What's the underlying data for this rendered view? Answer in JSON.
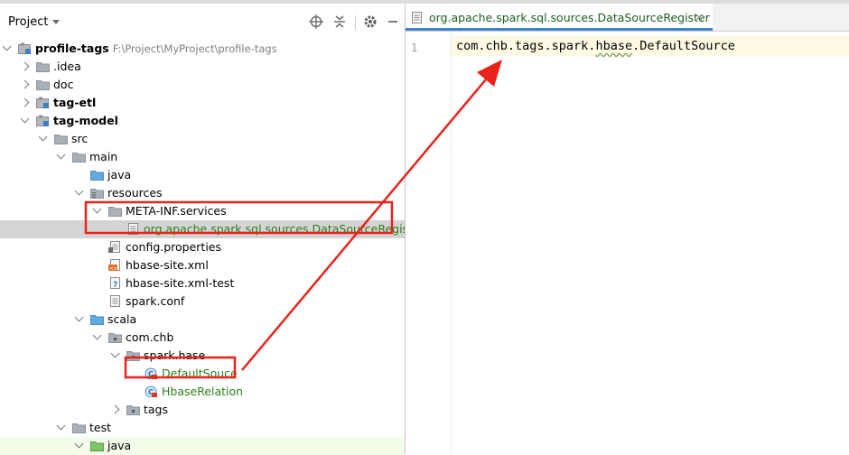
{
  "project_panel": {
    "title": "Project",
    "toolbar_icons": [
      "locate-icon",
      "collapse-icon",
      "gear-icon",
      "hide-icon"
    ]
  },
  "tree": [
    {
      "label": "profile-tags",
      "extra": "F:\\Project\\MyProject\\profile-tags",
      "bold": true,
      "icon": "module-icon",
      "expander": "open"
    },
    {
      "label": ".idea",
      "icon": "folder-icon",
      "expander": "closed"
    },
    {
      "label": "doc",
      "icon": "folder-icon",
      "expander": "closed"
    },
    {
      "label": "tag-etl",
      "bold": true,
      "icon": "module-icon",
      "expander": "closed"
    },
    {
      "label": "tag-model",
      "bold": true,
      "icon": "module-icon",
      "expander": "open"
    },
    {
      "label": "src",
      "icon": "folder-icon",
      "expander": "open"
    },
    {
      "label": "main",
      "icon": "folder-icon",
      "expander": "open"
    },
    {
      "label": "java",
      "icon": "source-folder-icon",
      "expander": "none"
    },
    {
      "label": "resources",
      "icon": "resources-folder-icon",
      "expander": "open"
    },
    {
      "label": "META-INF.services",
      "icon": "folder-icon",
      "expander": "open"
    },
    {
      "label": "org.apache.spark.sql.sources.DataSourceRegister",
      "icon": "text-file-icon",
      "expander": "none",
      "green": true,
      "selected": true
    },
    {
      "label": "config.properties",
      "icon": "properties-file-icon",
      "expander": "none"
    },
    {
      "label": "hbase-site.xml",
      "icon": "xml-file-icon",
      "expander": "none"
    },
    {
      "label": "hbase-site.xml-test",
      "icon": "unknown-file-icon",
      "expander": "none"
    },
    {
      "label": "spark.conf",
      "icon": "text-file-icon",
      "expander": "none"
    },
    {
      "label": "scala",
      "icon": "source-folder-icon",
      "expander": "open"
    },
    {
      "label": "com.chb",
      "icon": "package-icon",
      "expander": "open"
    },
    {
      "label": "spark.hase",
      "icon": "package-icon",
      "expander": "open"
    },
    {
      "label": "DefaultSouce",
      "icon": "scala-class-icon",
      "expander": "none",
      "green": true
    },
    {
      "label": "HbaseRelation",
      "icon": "scala-class-icon",
      "expander": "none",
      "green": true
    },
    {
      "label": "tags",
      "icon": "package-icon",
      "expander": "closed"
    },
    {
      "label": "test",
      "icon": "folder-icon",
      "expander": "open"
    },
    {
      "label": "java",
      "icon": "test-source-folder-icon",
      "expander": "open",
      "green_row": true
    }
  ],
  "editor": {
    "tab_label": "org.apache.spark.sql.sources.DataSourceRegister",
    "tab_close": "×",
    "line_number": "1",
    "code_pre": "com.chb.tags.spark.",
    "code_squiggle": "hbase",
    "code_post": ".DefaultSource"
  },
  "colors": {
    "annotation_red": "#e8231b",
    "selection": "#d4d4d4",
    "green_text": "#2e7d17",
    "tab_underline": "#4083c9"
  }
}
